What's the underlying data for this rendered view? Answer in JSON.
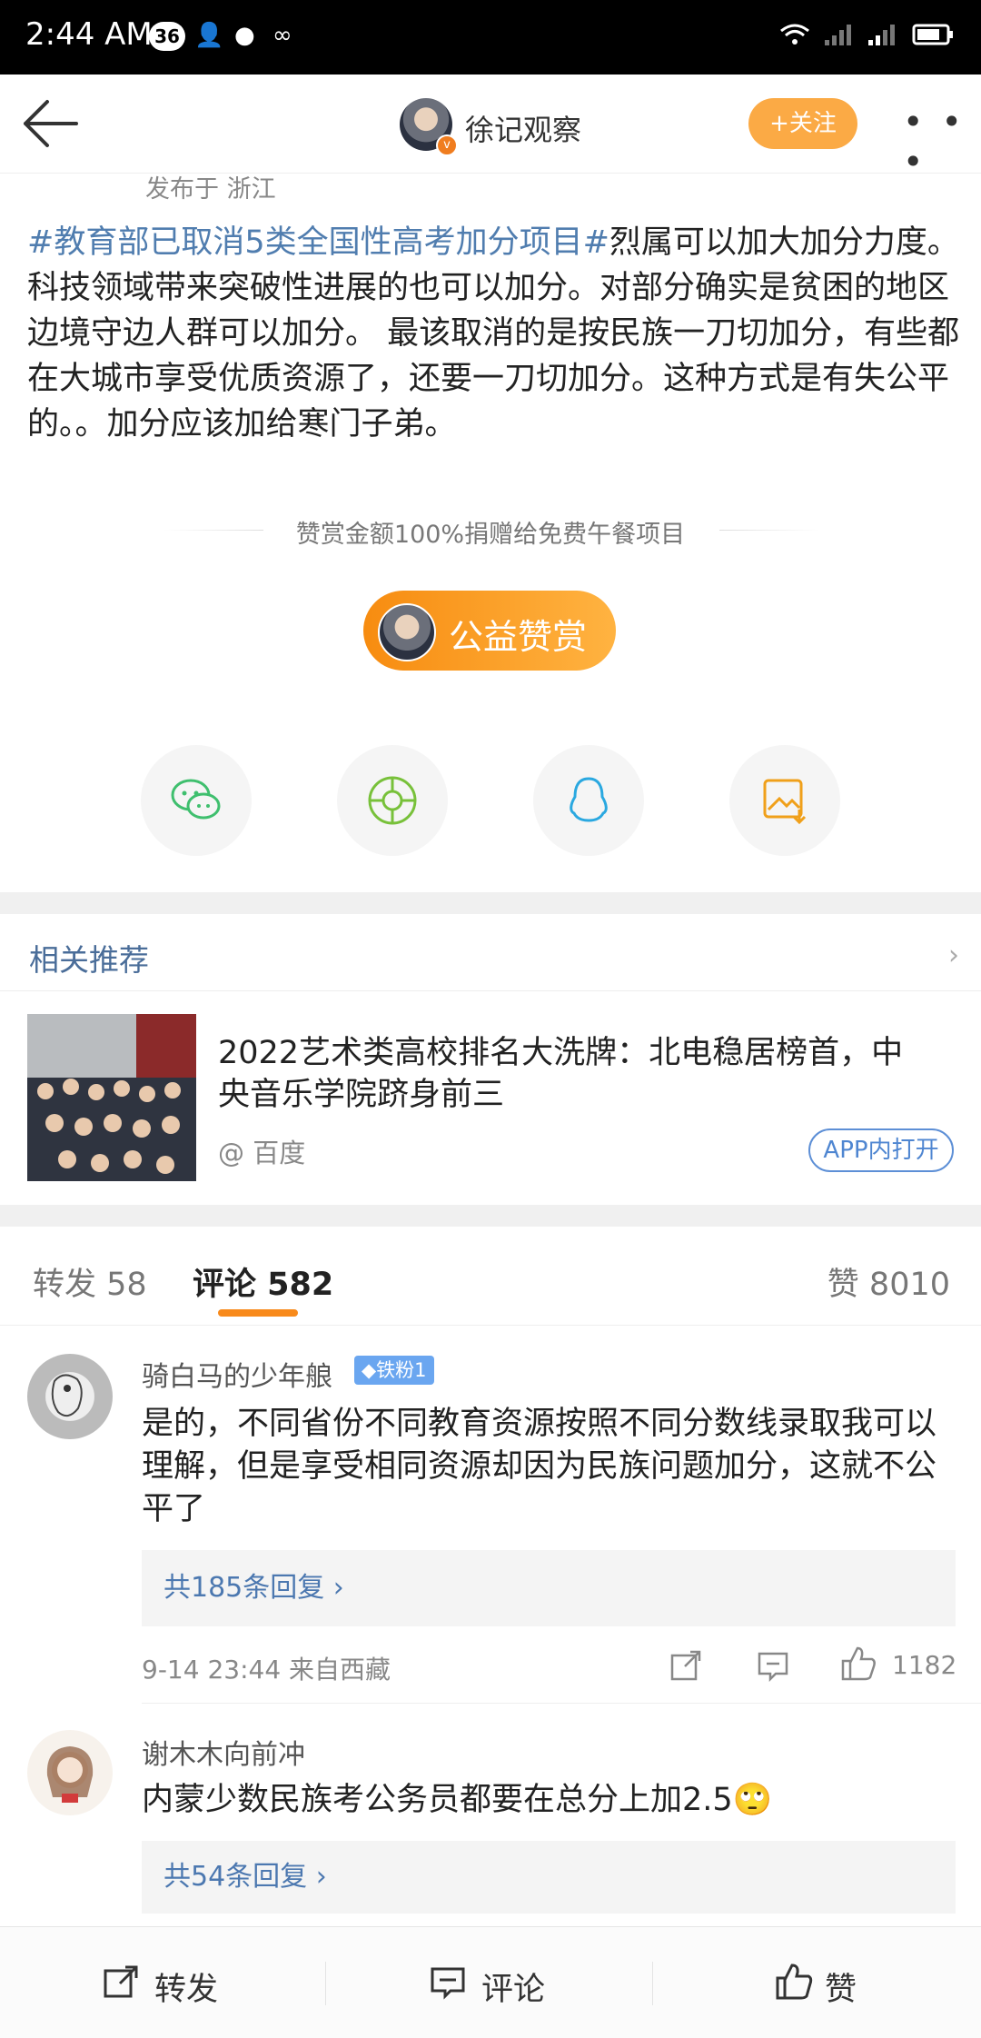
{
  "status_bar": {
    "time": "2:44 AM",
    "badge": "36"
  },
  "header": {
    "author_name": "徐记观察",
    "follow_label": "+关注",
    "more_label": "• • •"
  },
  "post": {
    "published_from": "发布于 浙江",
    "hashtag": "#教育部已取消5类全国性高考加分项目#",
    "body": "烈属可以加大加分力度。科技领域带来突破性进展的也可以加分。对部分确实是贫困的地区边境守边人群可以加分。 最该取消的是按民族一刀切加分，有些都在大城市享受优质资源了，还要一刀切加分。这种方式是有失公平的。。加分应该加给寒门子弟。"
  },
  "reward": {
    "note": "赞赏金额100%捐赠给免费午餐项目",
    "button_label": "公益赞赏"
  },
  "share_icons": [
    "wechat-icon",
    "moments-icon",
    "qq-icon",
    "save-image-icon"
  ],
  "recommend": {
    "section_title": "相关推荐",
    "item": {
      "title": "2022艺术类高校排名大洗牌：北电稳居榜首，中央音乐学院跻身前三",
      "source": "@ 百度",
      "open_label": "APP内打开"
    }
  },
  "tabs": {
    "repost": "转发 58",
    "comment": "评论 582",
    "like": "赞 8010"
  },
  "comments": [
    {
      "name": "骑白马的少年艆",
      "badge": "铁粉1",
      "text": "是的，不同省份不同教育资源按照不同分数线录取我可以理解，但是享受相同资源却因为民族问题加分，这就不公平了",
      "replies": "共185条回复 ›",
      "time": "9-14 23:44  来自西藏",
      "likes": "1182"
    },
    {
      "name": "谢木木向前冲",
      "text": "内蒙少数民族考公务员都要在总分上加2.5🙄",
      "replies": "共54条回复 ›"
    }
  ],
  "bottom_bar": {
    "repost": "转发",
    "comment": "评论",
    "like": "赞"
  }
}
